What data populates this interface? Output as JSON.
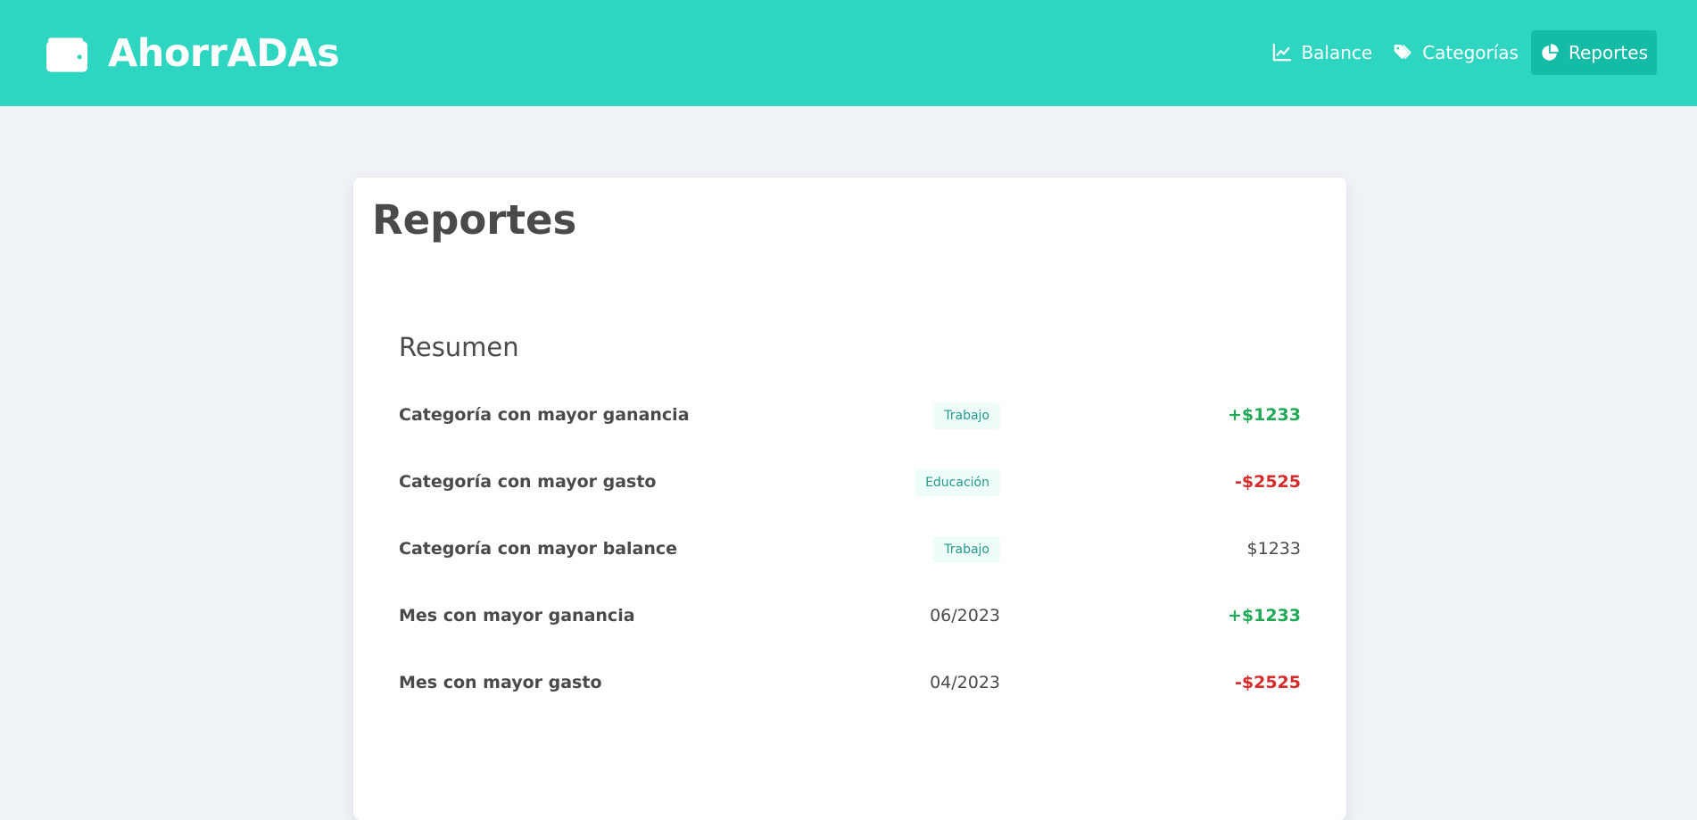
{
  "app": {
    "title": "AhorrADAs",
    "brand_icon": "wallet-icon",
    "accent_color": "#2ed5c0",
    "active_nav_color": "#15bca5"
  },
  "nav": {
    "items": [
      {
        "label": "Balance",
        "icon": "chart-line-icon",
        "active": false
      },
      {
        "label": "Categorías",
        "icon": "tags-icon",
        "active": false
      },
      {
        "label": "Reportes",
        "icon": "pie-chart-icon",
        "active": true
      }
    ]
  },
  "page": {
    "title": "Reportes",
    "section_title": "Resumen"
  },
  "summary": {
    "rows": [
      {
        "label": "Categoría con mayor ganancia",
        "middle": "Trabajo",
        "middle_type": "tag",
        "amount": "+$1233",
        "amount_type": "positive"
      },
      {
        "label": "Categoría con mayor gasto",
        "middle": "Educación",
        "middle_type": "tag",
        "amount": "-$2525",
        "amount_type": "negative"
      },
      {
        "label": "Categoría con mayor balance",
        "middle": "Trabajo",
        "middle_type": "tag",
        "amount": "$1233",
        "amount_type": "neutral"
      },
      {
        "label": "Mes con mayor ganancia",
        "middle": "06/2023",
        "middle_type": "date",
        "amount": "+$1233",
        "amount_type": "positive"
      },
      {
        "label": "Mes con mayor gasto",
        "middle": "04/2023",
        "middle_type": "date",
        "amount": "-$2525",
        "amount_type": "negative"
      }
    ]
  },
  "colors": {
    "positive": "#1fa855",
    "negative": "#d62b2b",
    "tag_bg": "#effdfa",
    "tag_text": "#24998a"
  }
}
